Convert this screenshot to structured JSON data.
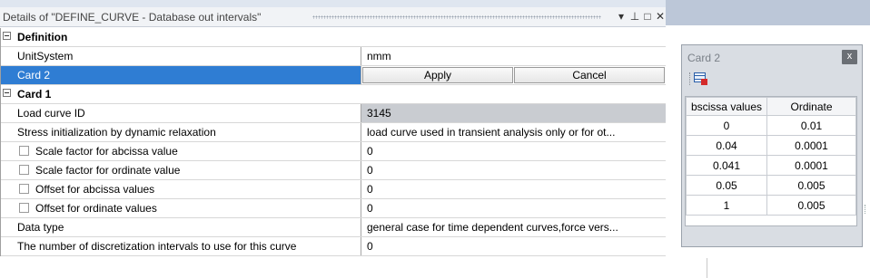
{
  "details": {
    "title": "Details of \"DEFINE_CURVE - Database out intervals\"",
    "window_buttons": [
      "▾",
      "⊥",
      "□",
      "✕"
    ],
    "definition": {
      "category": "Definition",
      "unit_system_label": "UnitSystem",
      "unit_system_value": "nmm",
      "card2_label": "Card 2",
      "apply_label": "Apply",
      "cancel_label": "Cancel"
    },
    "card1": {
      "category": "Card 1",
      "rows": [
        {
          "label": "Load curve ID",
          "value": "3145",
          "checkbox": false
        },
        {
          "label": "Stress initialization by dynamic relaxation",
          "value": "load curve used in transient analysis only or for ot...",
          "checkbox": false
        },
        {
          "label": "Scale factor for abcissa value",
          "value": "0",
          "checkbox": true
        },
        {
          "label": "Scale factor for ordinate value",
          "value": "0",
          "checkbox": true
        },
        {
          "label": "Offset for abcissa values",
          "value": "0",
          "checkbox": true
        },
        {
          "label": "Offset for ordinate values",
          "value": "0",
          "checkbox": true
        },
        {
          "label": "Data type",
          "value": "general case for time dependent curves,force vers...",
          "checkbox": false
        },
        {
          "label": "The number of discretization intervals to use for this curve",
          "value": "0",
          "checkbox": false
        }
      ]
    }
  },
  "card2_window": {
    "title": "Card 2",
    "close_glyph": "x",
    "columns": [
      "bscissa values",
      "Ordinate"
    ],
    "rows": [
      [
        "0",
        "0.01"
      ],
      [
        "0.04",
        "0.0001"
      ],
      [
        "0.041",
        "0.0001"
      ],
      [
        "0.05",
        "0.005"
      ],
      [
        "1",
        "0.005"
      ]
    ]
  },
  "colors": {
    "selection": "#2f7dd3",
    "readonly_cell": "#c9ccd1",
    "floating_window_bg": "#d9dde3"
  }
}
